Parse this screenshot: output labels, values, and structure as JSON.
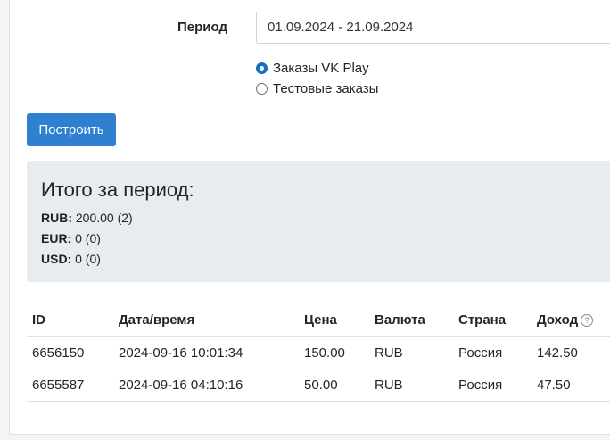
{
  "form": {
    "period_label": "Период",
    "period_value": "01.09.2024 - 21.09.2024",
    "options": [
      {
        "label": "Заказы VK Play",
        "checked": true
      },
      {
        "label": "Тестовые заказы",
        "checked": false
      }
    ],
    "build_label": "Построить"
  },
  "summary": {
    "title": "Итого за период:",
    "lines": [
      {
        "currency": "RUB:",
        "value": " 200.00 (2)"
      },
      {
        "currency": "EUR:",
        "value": " 0 (0)"
      },
      {
        "currency": "USD:",
        "value": " 0 (0)"
      }
    ]
  },
  "table": {
    "headers": [
      "ID",
      "Дата/время",
      "Цена",
      "Валюта",
      "Страна",
      "Доход"
    ],
    "help_icon": "question-circle-icon",
    "rows": [
      [
        "6656150",
        "2024-09-16 10:01:34",
        "150.00",
        "RUB",
        "Россия",
        "142.50"
      ],
      [
        "6655587",
        "2024-09-16 04:10:16",
        "50.00",
        "RUB",
        "Россия",
        "47.50"
      ]
    ]
  },
  "colors": {
    "accent": "#2f80d0",
    "summary_bg": "#e9ecef"
  }
}
